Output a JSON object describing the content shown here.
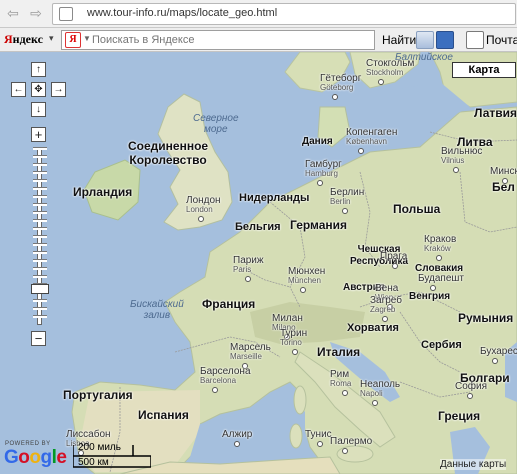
{
  "browser": {
    "back_glyph": "⇦",
    "forward_glyph": "⇨",
    "url": "www.tour-info.ru/maps/locate_geo.html"
  },
  "toolbar": {
    "logo_first": "Я",
    "logo_rest": "ндекс",
    "logo_dropdown": "▾",
    "search_icon": "Я",
    "search_placeholder": "Поискать в Яндексе",
    "find_button": "Найти",
    "mail_label": "Почта"
  },
  "map": {
    "type_button": "Карта",
    "pan": {
      "up": "↑",
      "down": "↓",
      "left": "←",
      "right": "→",
      "center": "✥"
    },
    "zoom_in": "+",
    "zoom_out": "−",
    "zoom_level_fraction": 0.8,
    "powered_by": "POWERED BY",
    "google_letters": [
      "G",
      "o",
      "o",
      "g",
      "l",
      "e"
    ],
    "google_colors": [
      "#3369e8",
      "#d50f25",
      "#eeb211",
      "#3369e8",
      "#009925",
      "#d50f25"
    ],
    "scale_top": "200 миль",
    "scale_bottom": "500 км",
    "copyright": "Данные карты",
    "countries": [
      "Соединенное\nКоролевство",
      "Ирландия",
      "Нидерланды",
      "Германия",
      "Бельгия",
      "Польша",
      "Латвия",
      "Литва",
      "Бел",
      "Франция",
      "Чешская\nРеспублика",
      "Словакия",
      "Австрия",
      "Венгрия",
      "Румыния",
      "Хорватия",
      "Сербия",
      "Италия",
      "Португалия",
      "Испания",
      "Греция",
      "Болгари",
      "Дания"
    ],
    "cities": [
      {
        "name": "Стокгольм",
        "latin": "Stockholm"
      },
      {
        "name": "Гётеборг",
        "latin": "Göteborg"
      },
      {
        "name": "Копенгаген",
        "latin": "København"
      },
      {
        "name": "Гамбург",
        "latin": "Hamburg"
      },
      {
        "name": "Берлин",
        "latin": "Berlin"
      },
      {
        "name": "Лондон",
        "latin": "London"
      },
      {
        "name": "Париж",
        "latin": "Paris"
      },
      {
        "name": "Мюнхен",
        "latin": "München"
      },
      {
        "name": "Прага",
        "latin": ""
      },
      {
        "name": "Краков",
        "latin": "Kraków"
      },
      {
        "name": "Вильнюс",
        "latin": "Vilnius"
      },
      {
        "name": "Минск",
        "latin": ""
      },
      {
        "name": "Вена",
        "latin": "Wien"
      },
      {
        "name": "Будапешт",
        "latin": ""
      },
      {
        "name": "Загреб",
        "latin": "Zagreb"
      },
      {
        "name": "Милан",
        "latin": "Milano"
      },
      {
        "name": "Турин",
        "latin": "Torino"
      },
      {
        "name": "Марсель",
        "latin": "Marseille"
      },
      {
        "name": "Барселона",
        "latin": "Barcelona"
      },
      {
        "name": "Рим",
        "latin": "Roma"
      },
      {
        "name": "Неаполь",
        "latin": "Napoli"
      },
      {
        "name": "Лиссабон",
        "latin": "Lisboa"
      },
      {
        "name": "Алжир",
        "latin": ""
      },
      {
        "name": "Тунис",
        "latin": ""
      },
      {
        "name": "Палермо",
        "latin": ""
      },
      {
        "name": "Бухарест",
        "latin": ""
      },
      {
        "name": "София",
        "latin": ""
      }
    ],
    "seas": [
      "Северное\nморе",
      "Бискайский\nзалив",
      "Балтийское"
    ]
  }
}
